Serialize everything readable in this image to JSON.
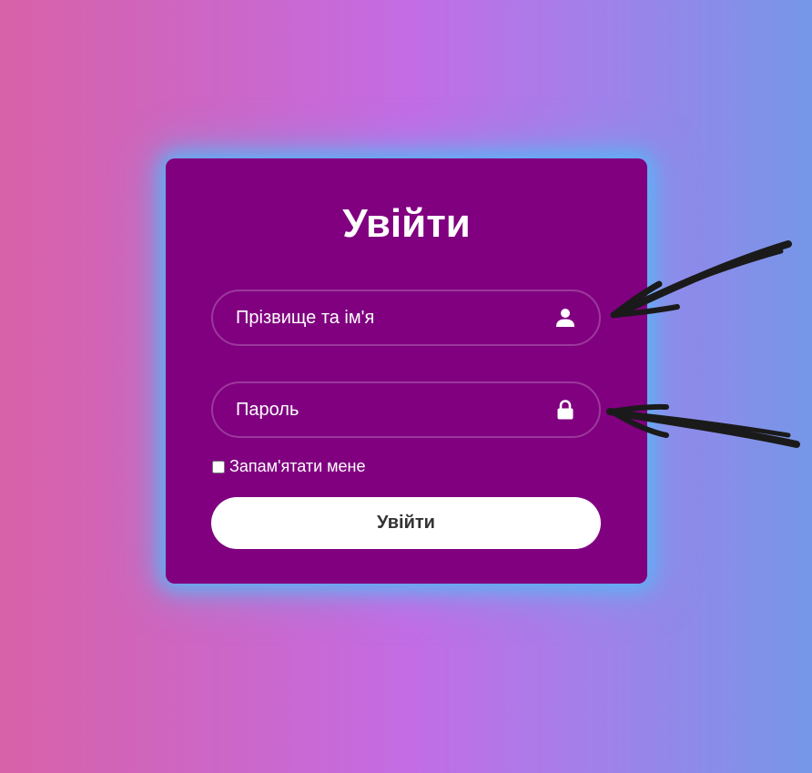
{
  "login": {
    "title": "Увійти",
    "username": {
      "placeholder": "Прізвище та ім'я",
      "value": "",
      "icon": "user-icon"
    },
    "password": {
      "placeholder": "Пароль",
      "value": "",
      "icon": "lock-icon"
    },
    "remember_label": "Запам'ятати мене",
    "remember_checked": false,
    "submit_label": "Увійти"
  },
  "colors": {
    "card_background": "#800080",
    "glow": "#5ab4f5",
    "text": "#ffffff",
    "button_background": "#ffffff",
    "button_text": "#333333",
    "annotation_arrows": "#1a1a1a"
  }
}
